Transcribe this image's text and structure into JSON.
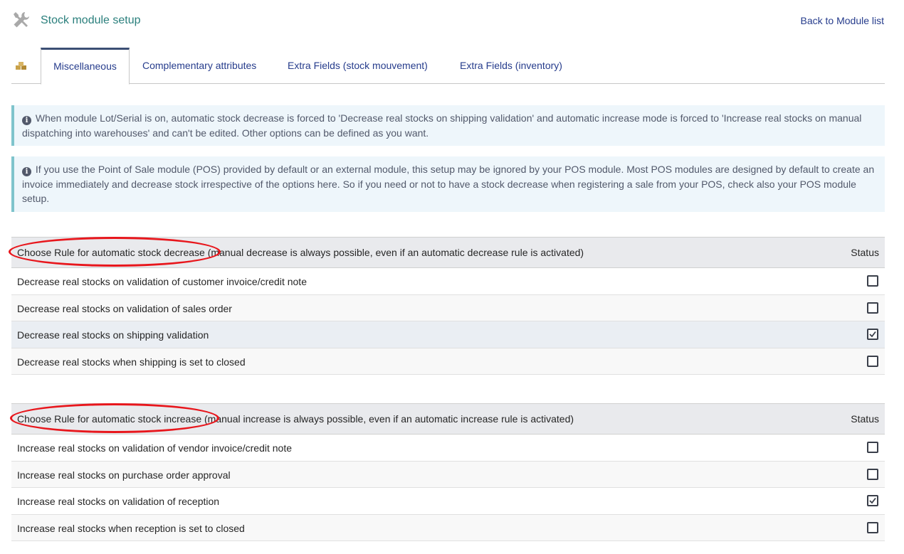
{
  "header": {
    "title": "Stock module setup",
    "back_link": "Back to Module list",
    "icon": "tools-icon"
  },
  "tabs": [
    {
      "label": "Miscellaneous",
      "active": true
    },
    {
      "label": "Complementary attributes",
      "active": false
    },
    {
      "label": "Extra Fields (stock mouvement)",
      "active": false
    },
    {
      "label": "Extra Fields (inventory)",
      "active": false
    }
  ],
  "info": [
    "When module Lot/Serial is on, automatic stock decrease is forced to 'Decrease real stocks on shipping validation' and automatic increase mode is forced to 'Increase real stocks on manual dispatching into warehouses' and can't be edited. Other options can be defined as you want.",
    "If you use the Point of Sale module (POS) provided by default or an external module, this setup may be ignored by your POS module. Most POS modules are designed by default to create an invoice immediately and decrease stock irrespective of the options here. So if you need or not to have a stock decrease when registering a sale from your POS, check also your POS module setup."
  ],
  "decrease": {
    "header": "Choose Rule for automatic stock decrease (manual decrease is always possible, even if an automatic decrease rule is activated)",
    "status_label": "Status",
    "rows": [
      {
        "label": "Decrease real stocks on validation of customer invoice/credit note",
        "checked": false
      },
      {
        "label": "Decrease real stocks on validation of sales order",
        "checked": false
      },
      {
        "label": "Decrease real stocks on shipping validation",
        "checked": true
      },
      {
        "label": "Decrease real stocks when shipping is set to closed",
        "checked": false
      }
    ]
  },
  "increase": {
    "header": "Choose Rule for automatic stock increase (manual increase is always possible, even if an automatic increase rule is activated)",
    "status_label": "Status",
    "rows": [
      {
        "label": "Increase real stocks on validation of vendor invoice/credit note",
        "checked": false
      },
      {
        "label": "Increase real stocks on purchase order approval",
        "checked": false
      },
      {
        "label": "Increase real stocks on validation of reception",
        "checked": true
      },
      {
        "label": "Increase real stocks when reception is set to closed",
        "checked": false
      }
    ]
  },
  "colors": {
    "title": "#2a7f7c",
    "link": "#263c8c",
    "info_bg": "#eef6fb",
    "info_border": "#7fc4cc",
    "annotation": "#e8161c"
  }
}
